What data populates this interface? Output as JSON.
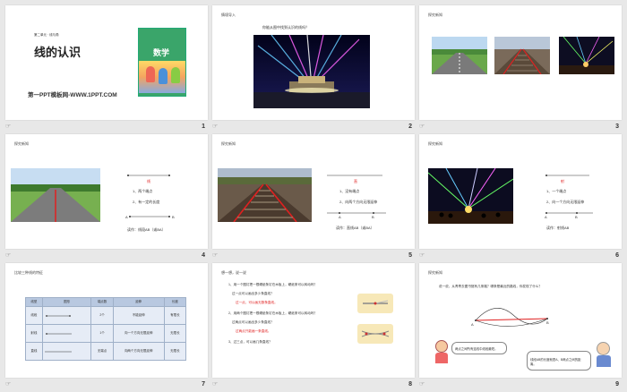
{
  "slides": [
    {
      "num": "1",
      "icon": "☞"
    },
    {
      "num": "2",
      "icon": "☞"
    },
    {
      "num": "3",
      "icon": "☞"
    },
    {
      "num": "4",
      "icon": "☞"
    },
    {
      "num": "5",
      "icon": "☞"
    },
    {
      "num": "6",
      "icon": "☞"
    },
    {
      "num": "7",
      "icon": "☞"
    },
    {
      "num": "8",
      "icon": "☞"
    },
    {
      "num": "9",
      "icon": "☞"
    }
  ],
  "s1": {
    "unit": "第二单元 · 线与角",
    "title": "线的认识",
    "site": "第一PPT模板网-WWW.1PPT.COM",
    "book_title": "数学"
  },
  "s2": {
    "section": "情境导入",
    "question": "你能从图中找到认识的线吗？"
  },
  "s3": {
    "section": "探究新知"
  },
  "s4": {
    "section": "探究新知",
    "label": "线",
    "p1": "1、两个端点",
    "p2": "2、有一定的长度",
    "a": "A",
    "b": "B",
    "caption": "读作：线段AB（或BA）"
  },
  "s5": {
    "section": "探究新知",
    "label": "直",
    "p1": "1、没有端点",
    "p2": "2、向两个方向无限延伸",
    "a": "A",
    "b": "B",
    "caption": "读作：直线AB（或BA）"
  },
  "s6": {
    "section": "探究新知",
    "label": "射",
    "p1": "1、一个端点",
    "p2": "2、向一个方向无限延伸",
    "a": "A",
    "b": "B",
    "caption": "读作：射线AB"
  },
  "s7": {
    "section": "比较三种线的特征",
    "headers": [
      "线型",
      "图形",
      "端点数",
      "延伸",
      "长度"
    ],
    "rows": [
      [
        "线段",
        "",
        "2个",
        "不能延伸",
        "有限长"
      ],
      [
        "射线",
        "",
        "1个",
        "向一个方向无限延伸",
        "无限长"
      ],
      [
        "直线",
        "",
        "无端点",
        "向两个方向无限延伸",
        "无限长"
      ]
    ]
  },
  "s8": {
    "section": "想一想，说一说",
    "q1": "1、用一个图钉把一根硬纸条钉在木板上，硬纸条可以转动吗？",
    "q1b": "过一点可以画出多少条直线？",
    "a1": "过一点，可以画无数条直线。",
    "q2": "2、用两个图钉把一根硬纸条钉在木板上，硬纸条可以转动吗？",
    "q2b": "过两点可以画出多少条直线？",
    "a2": "过两点只能画一条直线。",
    "q3": "3、过三点，可以画几条直线？"
  },
  "s9": {
    "section": "探究新知",
    "q": "说一说，从青青去图书馆有几条路？哪条是最近的路线，你发现了什么？",
    "a": "A",
    "b": "B",
    "bubble1": "两点之间所有连线中线段最短。",
    "bubble2": "线段AB的长度就是A、B两点之间的距离。"
  }
}
